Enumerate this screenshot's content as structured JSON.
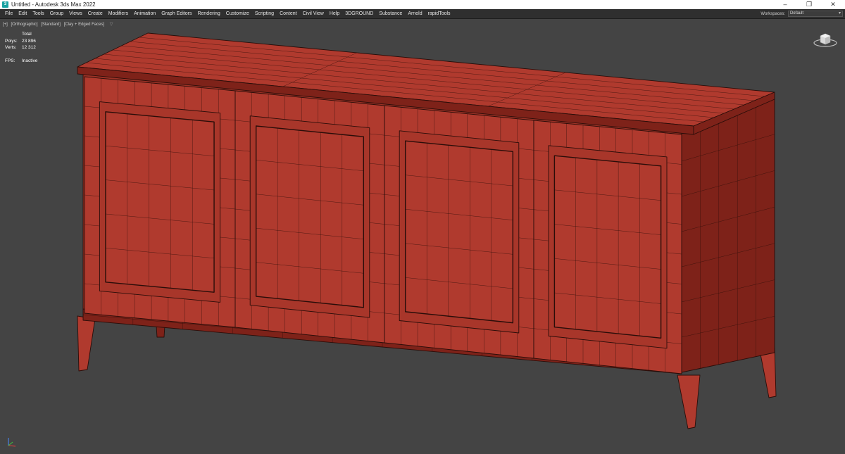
{
  "window": {
    "title": "Untitled - Autodesk 3ds Max 2022",
    "app_icon_glyph": "3",
    "controls": {
      "minimize": "–",
      "restore": "❐",
      "close": "✕"
    }
  },
  "menubar": {
    "items": [
      "File",
      "Edit",
      "Tools",
      "Group",
      "Views",
      "Create",
      "Modifiers",
      "Animation",
      "Graph Editors",
      "Rendering",
      "Customize",
      "Scripting",
      "Content",
      "Civil View",
      "Help",
      "3DGROUND",
      "Substance",
      "Arnold",
      "rapidTools"
    ],
    "workspaces_label": "Workspaces:",
    "workspace_value": "Default"
  },
  "viewport": {
    "labels": [
      "[+]",
      "[Orthographic]",
      "[Standard]",
      "[Clay + Edged Faces]"
    ],
    "filter_icon": "filter-icon",
    "stats": {
      "header": "Total",
      "polys_label": "Polys:",
      "polys_value": "23 896",
      "verts_label": "Verts:",
      "verts_value": "12 312",
      "fps_label": "FPS:",
      "fps_value": "Inactive"
    },
    "colors": {
      "background": "#444444",
      "model_fill": "#b03a2e",
      "model_dark": "#7e2219",
      "wire": "#2a0d09"
    }
  }
}
